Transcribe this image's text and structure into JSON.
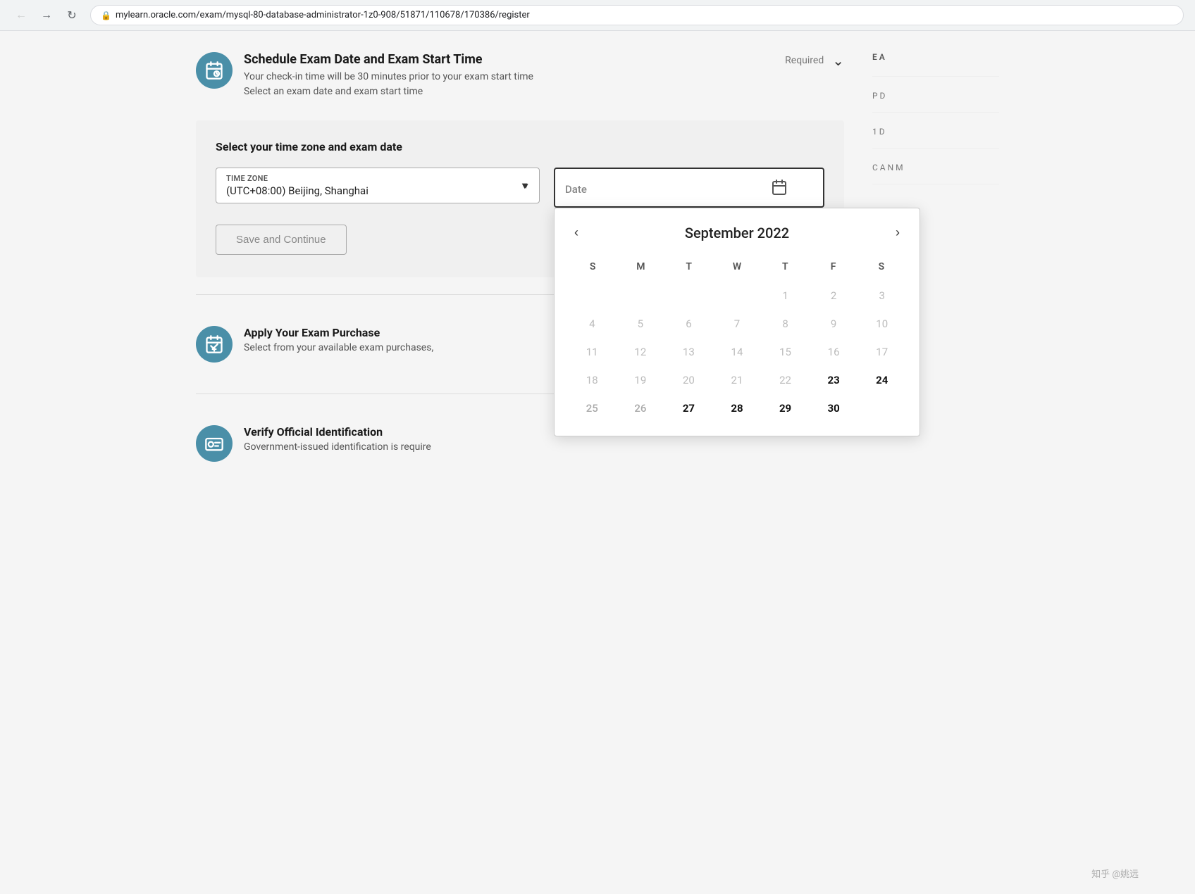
{
  "browser": {
    "url": "mylearn.oracle.com/exam/mysql-80-database-administrator-1z0-908/51871/110678/170386/register",
    "back_title": "Back",
    "forward_title": "Forward",
    "reload_title": "Reload"
  },
  "page": {
    "section1": {
      "title": "Schedule Exam Date and Exam Start Time",
      "subtitle1": "Your check-in time will be 30 minutes prior to your exam start time",
      "subtitle2": "Select an exam date and exam start time",
      "required_label": "Required"
    },
    "form": {
      "title": "Select your time zone and exam date",
      "timezone_label": "Time zone",
      "timezone_value": "(UTC+08:00) Beijing, Shanghai",
      "date_label": "Date",
      "save_button": "Save and Continue"
    },
    "calendar": {
      "month_year": "September 2022",
      "weekdays": [
        "S",
        "M",
        "T",
        "W",
        "T",
        "F",
        "S"
      ],
      "weeks": [
        [
          null,
          null,
          null,
          null,
          "1",
          "2",
          "3"
        ],
        [
          "4",
          "5",
          "6",
          "7",
          "8",
          "9",
          "10"
        ],
        [
          "11",
          "12",
          "13",
          "14",
          "15",
          "16",
          "17"
        ],
        [
          "18",
          "19",
          "20",
          "21",
          "22",
          "23",
          "24"
        ],
        [
          "25",
          "26",
          "27",
          "28",
          "29",
          "30",
          null
        ]
      ],
      "active_from": 23,
      "bold_days": [
        "23",
        "24",
        "27",
        "28",
        "29",
        "30"
      ]
    },
    "section2": {
      "title": "Apply Your Exam Purchase",
      "desc": "Select from your available exam purchases,"
    },
    "section3": {
      "title": "Verify Official Identification",
      "desc": "Government-issued identification is require"
    }
  }
}
